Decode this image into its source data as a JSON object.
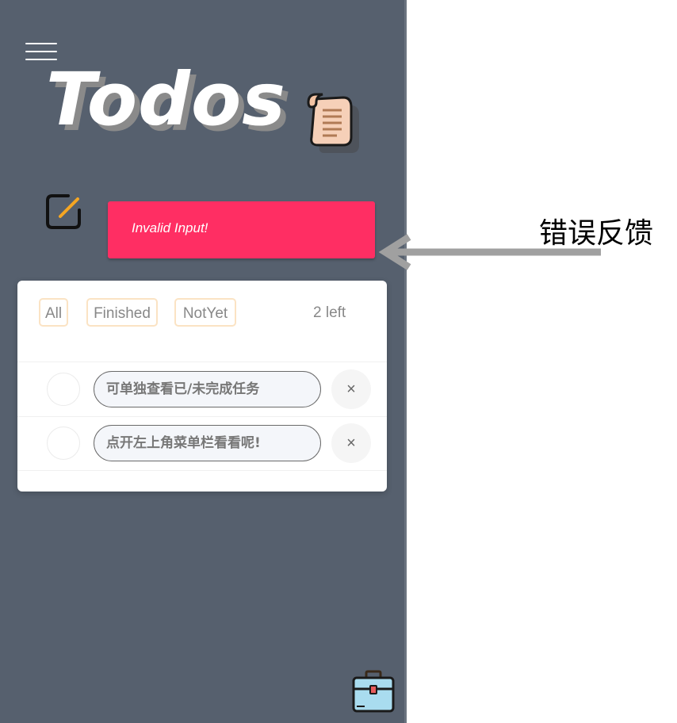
{
  "header": {
    "title": "Todos",
    "menu_icon": "hamburger-menu-icon",
    "title_icon": "scroll-icon"
  },
  "input": {
    "edit_icon": "edit-icon",
    "error_message": "Invalid Input!",
    "error_color": "#ff2e63"
  },
  "filters": {
    "all": "All",
    "finished": "Finished",
    "not_yet": "NotYet",
    "left_count": "2 left"
  },
  "todos": [
    {
      "text": "可单独查看已/未完成任务",
      "done": false,
      "delete_label": "×"
    },
    {
      "text": "点开左上角菜单栏看看呢!",
      "done": false,
      "delete_label": "×"
    }
  ],
  "footer": {
    "toolbox_icon": "toolbox-icon"
  },
  "annotation": {
    "label": "错误反馈"
  },
  "colors": {
    "sidebar_bg": "#56606e",
    "filter_border": "#fbe3c4",
    "error_bg": "#ff2e63"
  }
}
